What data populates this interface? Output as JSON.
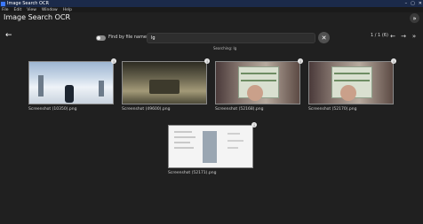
{
  "window": {
    "title": "Image Search OCR",
    "controls": [
      "–",
      "▢",
      "✕"
    ]
  },
  "menu": [
    "File",
    "Edit",
    "View",
    "Window",
    "Help"
  ],
  "app": {
    "heading": "Image Search OCR"
  },
  "toolbar": {
    "back_icon": "arrow-left-icon",
    "toggle_label": "Find by file name",
    "search_value": "lg",
    "status": "Searching: lg",
    "page_indicator": "1 / 1 (6)",
    "prev_icon": "arrow-left-icon",
    "next_icon": "arrow-right-icon",
    "last_icon": "double-chevron-right-icon",
    "clear_icon": "close-icon"
  },
  "results": [
    {
      "caption": "Screenshot (10350).png",
      "badge": "i"
    },
    {
      "caption": "Screenshot (49600).png",
      "badge": "i"
    },
    {
      "caption": "Screenshot (52168).png",
      "badge": "i"
    },
    {
      "caption": "Screenshot (52170).png",
      "badge": "i"
    },
    {
      "caption": "Screenshot (52171).png",
      "badge": "i"
    }
  ],
  "colors": {
    "background": "#202020",
    "titlebar": "#1b2a4a",
    "accent": "#3b78ff"
  }
}
